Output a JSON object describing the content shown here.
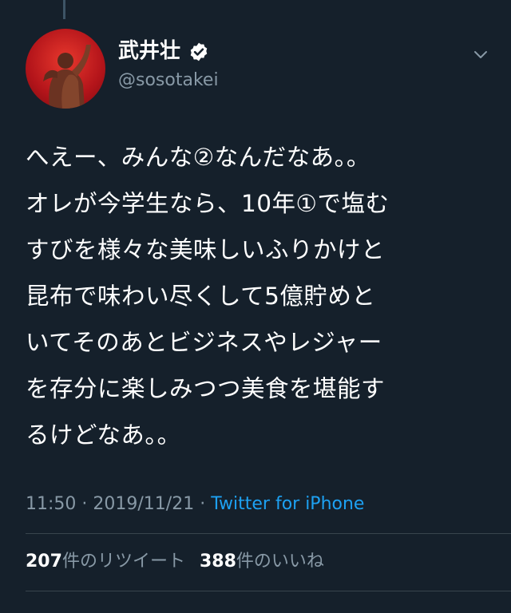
{
  "author": {
    "display_name": "武井壮",
    "handle": "@sosotakei",
    "verified": true
  },
  "tweet": {
    "text": "へえー、みんな②なんだなあ。。\nオレが今学生なら、10年①で塩む\nすびを様々な美味しいふりかけと\n昆布で味わい尽くして5億貯めと\nいてそのあとビジネスやレジャー\nを存分に楽しみつつ美食を堪能す\nるけどなあ。。",
    "time": "11:50",
    "separator": "·",
    "date": "2019/11/21",
    "source": "Twitter for iPhone"
  },
  "stats": {
    "retweets_count": "207",
    "retweets_label": "件のリツイート",
    "likes_count": "388",
    "likes_label": "件のいいね"
  },
  "colors": {
    "background": "#15202b",
    "secondary_text": "#8899a6",
    "accent": "#1da1f2",
    "divider": "#38444d"
  },
  "icons": {
    "verified": "verified-badge-icon",
    "more": "chevron-down-icon"
  }
}
